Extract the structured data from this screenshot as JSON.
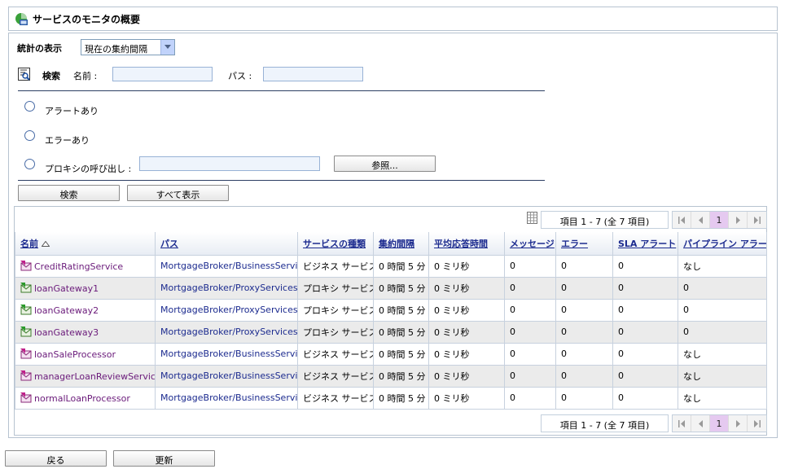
{
  "header": {
    "title": "サービスのモニタの概要"
  },
  "stats": {
    "label": "統計の表示",
    "selected": "現在の集約間隔"
  },
  "search": {
    "label": "検索",
    "name_label": "名前 :",
    "path_label": "パス :",
    "name_value": "",
    "path_value": ""
  },
  "filters": {
    "alerts": "アラートあり",
    "errors": "エラーあり",
    "proxy_call": "プロキシの呼び出し :",
    "proxy_value": "",
    "browse": "参照..."
  },
  "actions": {
    "search": "検索",
    "show_all": "すべて表示"
  },
  "pager": {
    "info": "項目 1 - 7 (全 7 項目)",
    "current_page": "1"
  },
  "table": {
    "columns": [
      "名前",
      "パス",
      "サービスの種類",
      "集約間隔",
      "平均応答時間",
      "メッセージ",
      "エラー",
      "SLA アラート",
      "パイプライン アラート"
    ],
    "rows": [
      {
        "name": "CreditRatingService",
        "path": "MortgageBroker/BusinessServices",
        "type": "ビジネス サービス",
        "interval": "0 時間 5 分",
        "avg": "0 ミリ秒",
        "messages": "0",
        "errors": "0",
        "sla": "0",
        "pipeline": "なし",
        "kind": "business"
      },
      {
        "name": "loanGateway1",
        "path": "MortgageBroker/ProxyServices",
        "type": "プロキシ サービス",
        "interval": "0 時間 5 分",
        "avg": "0 ミリ秒",
        "messages": "0",
        "errors": "0",
        "sla": "0",
        "pipeline": "0",
        "kind": "proxy"
      },
      {
        "name": "loanGateway2",
        "path": "MortgageBroker/ProxyServices",
        "type": "プロキシ サービス",
        "interval": "0 時間 5 分",
        "avg": "0 ミリ秒",
        "messages": "0",
        "errors": "0",
        "sla": "0",
        "pipeline": "0",
        "kind": "proxy"
      },
      {
        "name": "loanGateway3",
        "path": "MortgageBroker/ProxyServices",
        "type": "プロキシ サービス",
        "interval": "0 時間 5 分",
        "avg": "0 ミリ秒",
        "messages": "0",
        "errors": "0",
        "sla": "0",
        "pipeline": "0",
        "kind": "proxy"
      },
      {
        "name": "loanSaleProcessor",
        "path": "MortgageBroker/BusinessServices",
        "type": "ビジネス サービス",
        "interval": "0 時間 5 分",
        "avg": "0 ミリ秒",
        "messages": "0",
        "errors": "0",
        "sla": "0",
        "pipeline": "なし",
        "kind": "business"
      },
      {
        "name": "managerLoanReviewService",
        "path": "MortgageBroker/BusinessServices",
        "type": "ビジネス サービス",
        "interval": "0 時間 5 分",
        "avg": "0 ミリ秒",
        "messages": "0",
        "errors": "0",
        "sla": "0",
        "pipeline": "なし",
        "kind": "business"
      },
      {
        "name": "normalLoanProcessor",
        "path": "MortgageBroker/BusinessServices",
        "type": "ビジネス サービス",
        "interval": "0 時間 5 分",
        "avg": "0 ミリ秒",
        "messages": "0",
        "errors": "0",
        "sla": "0",
        "pipeline": "なし",
        "kind": "business"
      }
    ]
  },
  "footer": {
    "back": "戻る",
    "refresh": "更新"
  },
  "colors": {
    "link": "#1c2b8f",
    "service_link": "#6a1a7a",
    "alt_row": "#ebebeb",
    "current_page": "#e5c9f0"
  }
}
